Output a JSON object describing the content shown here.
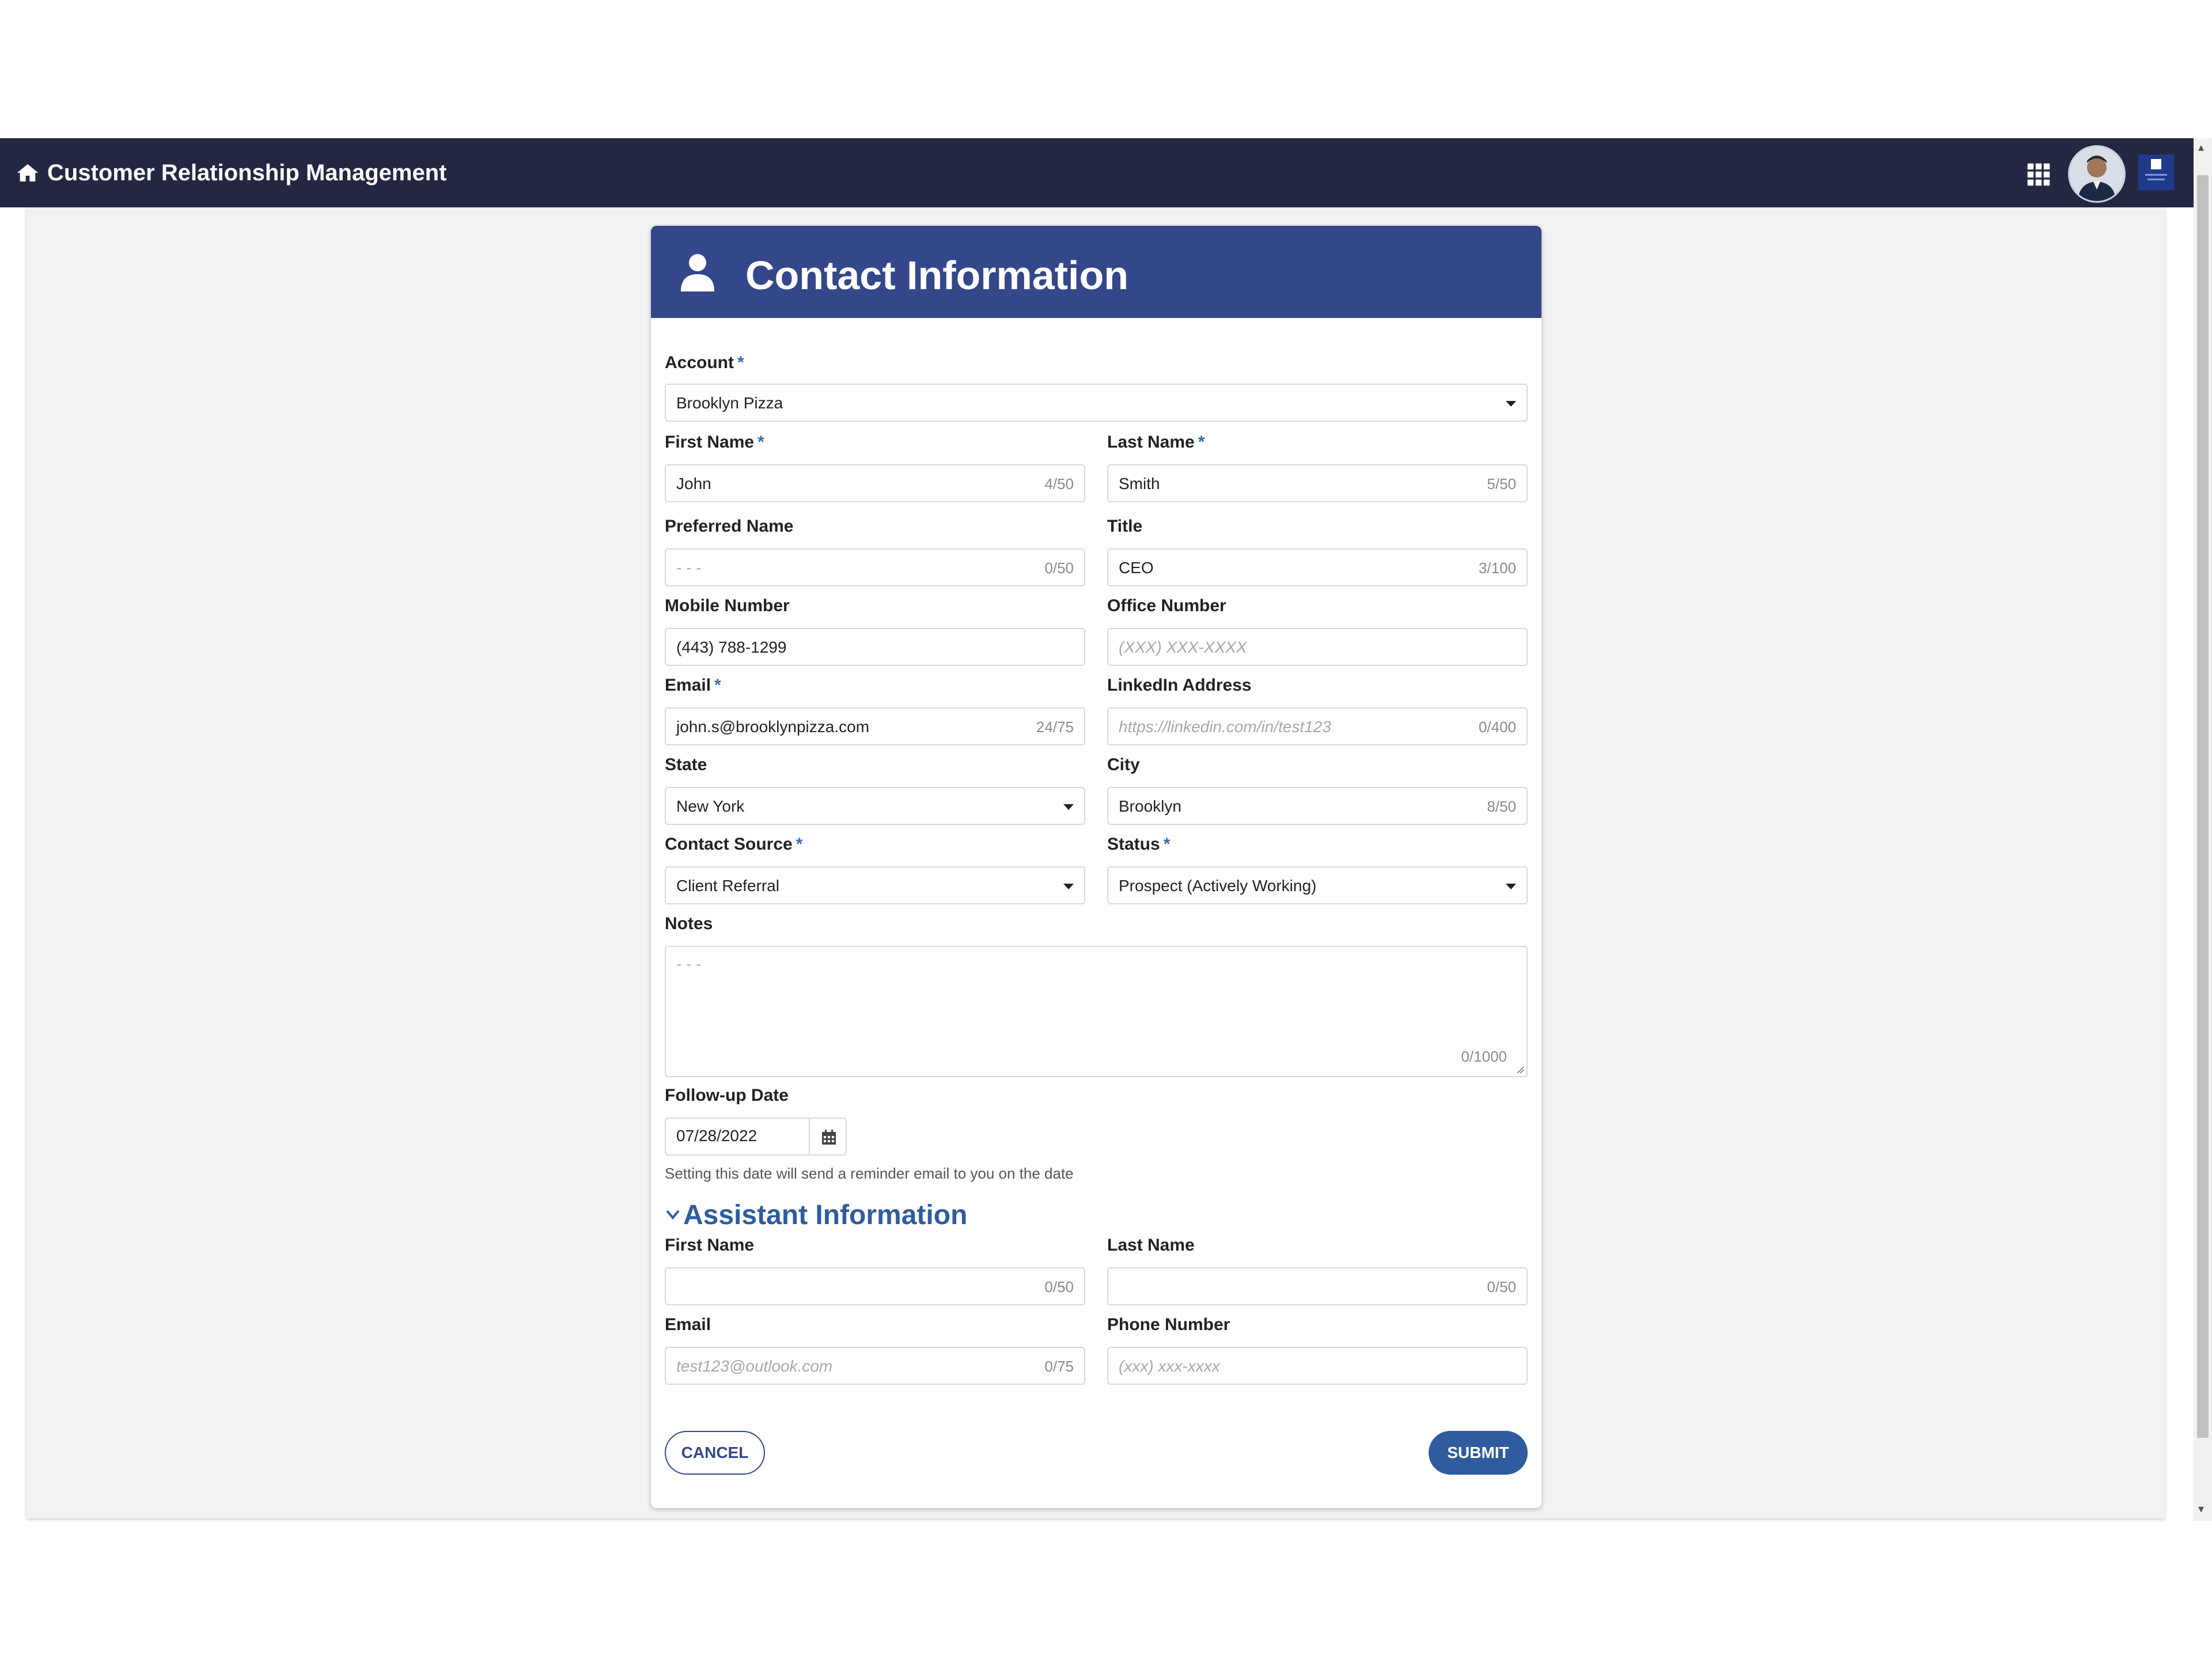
{
  "app": {
    "title": "Customer Relationship Management"
  },
  "header": {
    "icons": [
      "home-icon",
      "grid-icon",
      "avatar",
      "brand-logo"
    ]
  },
  "card": {
    "title": "Contact Information"
  },
  "form": {
    "account": {
      "label": "Account",
      "required": "*",
      "value": "Brooklyn Pizza"
    },
    "first_name": {
      "label": "First Name",
      "required": "*",
      "value": "John",
      "count": "4/50"
    },
    "last_name": {
      "label": "Last Name",
      "required": "*",
      "value": "Smith",
      "count": "5/50"
    },
    "preferred_name": {
      "label": "Preferred Name",
      "placeholder": "- - -",
      "count": "0/50"
    },
    "title": {
      "label": "Title",
      "value": "CEO",
      "count": "3/100"
    },
    "mobile": {
      "label": "Mobile Number",
      "value": "(443) 788-1299"
    },
    "office": {
      "label": "Office Number",
      "placeholder": "(XXX) XXX-XXXX"
    },
    "email": {
      "label": "Email",
      "required": "*",
      "value": "john.s@brooklynpizza.com",
      "count": "24/75"
    },
    "linkedin": {
      "label": "LinkedIn Address",
      "placeholder": "https://linkedin.com/in/test123",
      "count": "0/400"
    },
    "state": {
      "label": "State",
      "value": "New York"
    },
    "city": {
      "label": "City",
      "value": "Brooklyn",
      "count": "8/50"
    },
    "contact_source": {
      "label": "Contact Source",
      "required": "*",
      "value": "Client Referral"
    },
    "status": {
      "label": "Status",
      "required": "*",
      "value": "Prospect (Actively Working)"
    },
    "notes": {
      "label": "Notes",
      "placeholder": "- - -",
      "count": "0/1000"
    },
    "followup": {
      "label": "Follow-up Date",
      "value": "07/28/2022",
      "hint": "Setting this date will send a reminder email to you on the date"
    }
  },
  "assistant": {
    "section_title": "Assistant Information",
    "first_name": {
      "label": "First Name",
      "count": "0/50"
    },
    "last_name": {
      "label": "Last Name",
      "count": "0/50"
    },
    "email": {
      "label": "Email",
      "placeholder": "test123@outlook.com",
      "count": "0/75"
    },
    "phone": {
      "label": "Phone Number",
      "placeholder": "(xxx) xxx-xxxx"
    }
  },
  "buttons": {
    "cancel": "CANCEL",
    "submit": "SUBMIT"
  },
  "colors": {
    "nav": "#232742",
    "header": "#34478a",
    "accent": "#2f5c9c",
    "required": "#3b6bb0"
  }
}
